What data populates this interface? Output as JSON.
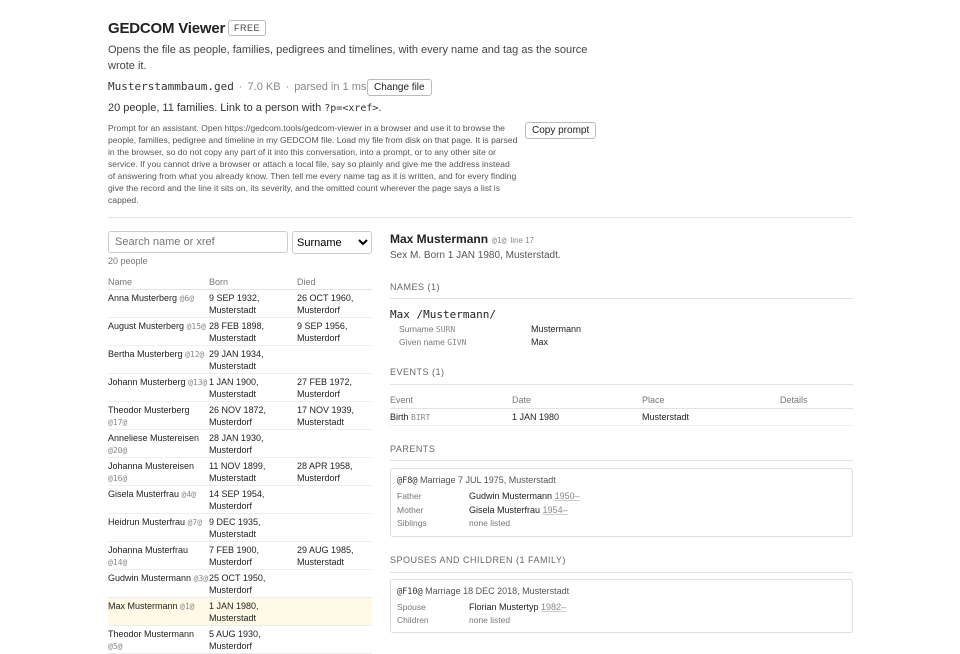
{
  "app": {
    "title": "GEDCOM Viewer",
    "badge": "FREE",
    "description": "Opens the file as people, families, pedigrees and timelines, with every name and tag as the source wrote it."
  },
  "file": {
    "name": "Musterstammbaum.ged",
    "size": "7.0 KB",
    "parsed": "parsed in 1 ms",
    "change_label": "Change file"
  },
  "summary": {
    "text": "20 people, 11 families. Link to a person with ",
    "code": "?p=<xref>",
    "end": "."
  },
  "prompt": {
    "text": "Prompt for an assistant. Open https://gedcom.tools/gedcom-viewer in a browser and use it to browse the people, families, pedigree and timeline in my GEDCOM file. Load my file from disk on that page. It is parsed in the browser, so do not copy any part of it into this conversation, into a prompt, or to any other site or service. If you cannot drive a browser or attach a local file, say so plainly and give me the address instead of answering from what you already know. Then tell me every name tag as it is written, and for every finding give the record and the line it sits on, its severity, and the omitted count wherever the page says a list is capped.",
    "copy_label": "Copy prompt"
  },
  "search": {
    "placeholder": "Search name or xref",
    "sort_selected": "Surname",
    "count": "20 people"
  },
  "people_table": {
    "headers": [
      "Name",
      "Born",
      "Died"
    ],
    "rows": [
      {
        "name": "Anna Musterberg",
        "xref": "@6@",
        "born": "9 SEP 1932, Musterstadt",
        "died": "26 OCT 1960, Musterdorf"
      },
      {
        "name": "August Musterberg",
        "xref": "@15@",
        "born": "28 FEB 1898, Musterstadt",
        "died": "9 SEP 1956, Musterdorf"
      },
      {
        "name": "Bertha Musterberg",
        "xref": "@12@",
        "born": "29 JAN 1934, Musterstadt",
        "died": ""
      },
      {
        "name": "Johann Musterberg",
        "xref": "@13@",
        "born": "1 JAN 1900, Musterstadt",
        "died": "27 FEB 1972, Musterdorf"
      },
      {
        "name": "Theodor Musterberg",
        "xref": "@17@",
        "born": "26 NOV 1872, Musterdorf",
        "died": "17 NOV 1939, Musterstadt"
      },
      {
        "name": "Anneliese Mustereisen",
        "xref": "@20@",
        "born": "28 JAN 1930, Musterdorf",
        "died": ""
      },
      {
        "name": "Johanna Mustereisen",
        "xref": "@16@",
        "born": "11 NOV 1899, Musterstadt",
        "died": "28 APR 1958, Musterdorf"
      },
      {
        "name": "Gisela Musterfrau",
        "xref": "@4@",
        "born": "14 SEP 1954, Musterdorf",
        "died": ""
      },
      {
        "name": "Heidrun Musterfrau",
        "xref": "@7@",
        "born": "9 DEC 1935, Musterstadt",
        "died": ""
      },
      {
        "name": "Johanna Musterfrau",
        "xref": "@14@",
        "born": "7 FEB 1900, Musterdorf",
        "died": "29 AUG 1985, Musterstadt"
      },
      {
        "name": "Gudwin Mustermann",
        "xref": "@3@",
        "born": "25 OCT 1950, Musterdorf",
        "died": ""
      },
      {
        "name": "Max Mustermann",
        "xref": "@1@",
        "born": "1 JAN 1980, Musterstadt",
        "died": "",
        "selected": true
      },
      {
        "name": "Theodor Mustermann",
        "xref": "@5@",
        "born": "5 AUG 1930, Musterdorf",
        "died": ""
      }
    ]
  },
  "person": {
    "name": "Max Mustermann",
    "xref": "@1@",
    "line": "line 17",
    "subtitle": "Sex M. Born 1 JAN 1980, Musterstadt.",
    "names_heading": "NAMES (1)",
    "name_raw": "Max /Mustermann/",
    "name_parts": [
      {
        "label": "Surname",
        "tag": "SURN",
        "value": "Mustermann"
      },
      {
        "label": "Given name",
        "tag": "GIVN",
        "value": "Max"
      }
    ],
    "events_heading": "EVENTS (1)",
    "events_headers": [
      "Event",
      "Date",
      "Place",
      "Details"
    ],
    "events": [
      {
        "event": "Birth",
        "tag": "BIRT",
        "date": "1 JAN 1980",
        "place": "Musterstadt",
        "details": ""
      }
    ],
    "parents_heading": "PARENTS",
    "parents_family": {
      "xref": "@F8@",
      "desc": "Marriage 7 JUL 1975, Musterstadt",
      "father_label": "Father",
      "father": "Gudwin Mustermann",
      "father_span": "1950–",
      "mother_label": "Mother",
      "mother": "Gisela Musterfrau",
      "mother_span": "1954–",
      "siblings_label": "Siblings",
      "siblings": "none listed"
    },
    "spouses_heading": "SPOUSES AND CHILDREN (1 FAMILY)",
    "spouse_family": {
      "xref": "@F10@",
      "desc": "Marriage 18 DEC 2018, Musterstadt",
      "spouse_label": "Spouse",
      "spouse": "Florian Mustertyp",
      "spouse_span": "1982–",
      "children_label": "Children",
      "children": "none listed"
    }
  }
}
